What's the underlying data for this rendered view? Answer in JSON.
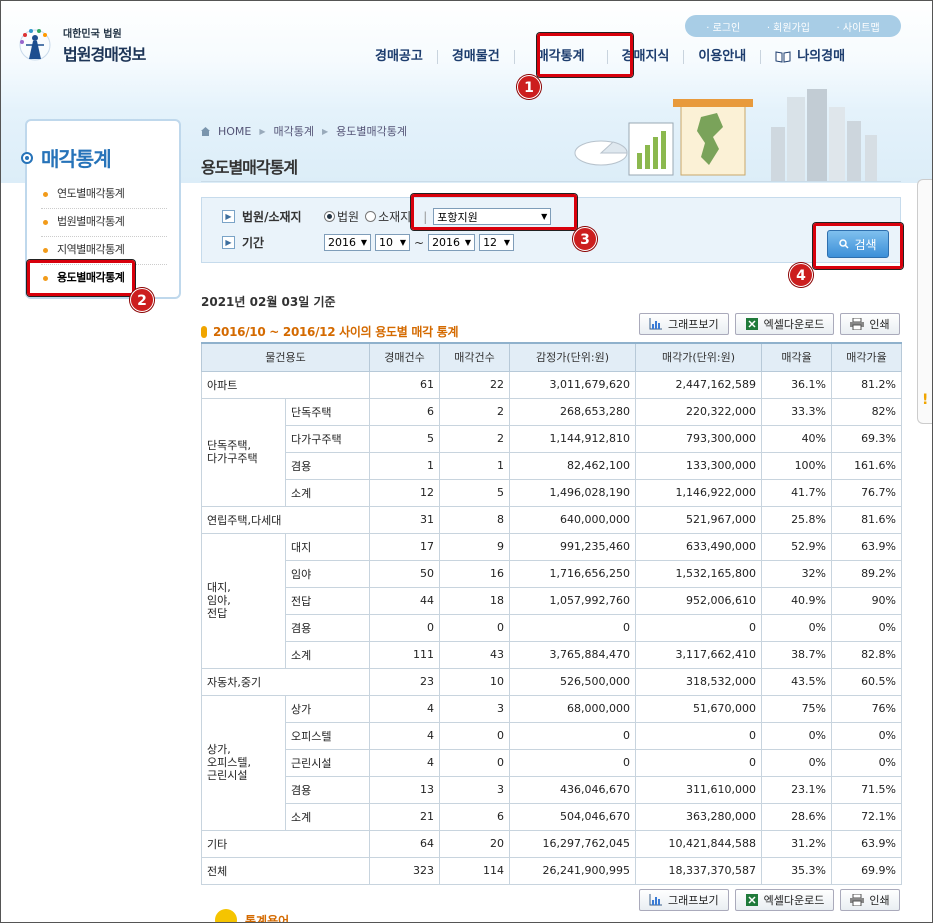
{
  "logo": {
    "subtitle": "대한민국 법원",
    "title": "법원경매정보"
  },
  "util_links": [
    "로그인",
    "회원가입",
    "사이트맵"
  ],
  "gnb": [
    "경매공고",
    "경매물건",
    "매각통계",
    "경매지식",
    "이용안내",
    "나의경매"
  ],
  "lnb": {
    "title": "매각통계",
    "items": [
      "연도별매각통계",
      "법원별매각통계",
      "지역별매각통계",
      "용도별매각통계"
    ]
  },
  "breadcrumb": [
    "HOME",
    "매각통계",
    "용도별매각통계"
  ],
  "page_title": "용도별매각통계",
  "search": {
    "court_label": "법원/소재지",
    "radio_court": "법원",
    "radio_location": "소재지",
    "court_value": "포항지원",
    "period_label": "기간",
    "from_year": "2016",
    "from_month": "10",
    "tilde": "~",
    "to_year": "2016",
    "to_month": "12",
    "search_button": "검색"
  },
  "annotations": [
    "1",
    "2",
    "3",
    "4"
  ],
  "date_basis": "2021년 02월 03일 기준",
  "section_title": "2016/10 ~ 2016/12 사이의 용도별 매각 통계",
  "toolbar": {
    "graph": "그래프보기",
    "excel": "엑셀다운로드",
    "print": "인쇄"
  },
  "table": {
    "headers": [
      "물건용도",
      "경매건수",
      "매각건수",
      "감정가(단위:원)",
      "매각가(단위:원)",
      "매각율",
      "매각가율"
    ],
    "rows": [
      {
        "group": "아파트",
        "sub": "",
        "c1": "61",
        "c2": "22",
        "c3": "3,011,679,620",
        "c4": "2,447,162,589",
        "c5": "36.1%",
        "c6": "81.2%"
      },
      {
        "group": "단독주택,\n다가구주택",
        "sub": "단독주택",
        "c1": "6",
        "c2": "2",
        "c3": "268,653,280",
        "c4": "220,322,000",
        "c5": "33.3%",
        "c6": "82%"
      },
      {
        "group": "",
        "sub": "다가구주택",
        "c1": "5",
        "c2": "2",
        "c3": "1,144,912,810",
        "c4": "793,300,000",
        "c5": "40%",
        "c6": "69.3%"
      },
      {
        "group": "",
        "sub": "겸용",
        "c1": "1",
        "c2": "1",
        "c3": "82,462,100",
        "c4": "133,300,000",
        "c5": "100%",
        "c6": "161.6%"
      },
      {
        "group": "",
        "sub": "소계",
        "c1": "12",
        "c2": "5",
        "c3": "1,496,028,190",
        "c4": "1,146,922,000",
        "c5": "41.7%",
        "c6": "76.7%"
      },
      {
        "group": "연립주택,다세대",
        "sub": "",
        "c1": "31",
        "c2": "8",
        "c3": "640,000,000",
        "c4": "521,967,000",
        "c5": "25.8%",
        "c6": "81.6%"
      },
      {
        "group": "대지,\n임야,\n전답",
        "sub": "대지",
        "c1": "17",
        "c2": "9",
        "c3": "991,235,460",
        "c4": "633,490,000",
        "c5": "52.9%",
        "c6": "63.9%"
      },
      {
        "group": "",
        "sub": "임야",
        "c1": "50",
        "c2": "16",
        "c3": "1,716,656,250",
        "c4": "1,532,165,800",
        "c5": "32%",
        "c6": "89.2%"
      },
      {
        "group": "",
        "sub": "전답",
        "c1": "44",
        "c2": "18",
        "c3": "1,057,992,760",
        "c4": "952,006,610",
        "c5": "40.9%",
        "c6": "90%"
      },
      {
        "group": "",
        "sub": "겸용",
        "c1": "0",
        "c2": "0",
        "c3": "0",
        "c4": "0",
        "c5": "0%",
        "c6": "0%"
      },
      {
        "group": "",
        "sub": "소계",
        "c1": "111",
        "c2": "43",
        "c3": "3,765,884,470",
        "c4": "3,117,662,410",
        "c5": "38.7%",
        "c6": "82.8%"
      },
      {
        "group": "자동차,중기",
        "sub": "",
        "c1": "23",
        "c2": "10",
        "c3": "526,500,000",
        "c4": "318,532,000",
        "c5": "43.5%",
        "c6": "60.5%"
      },
      {
        "group": "상가,\n오피스텔,\n근린시설",
        "sub": "상가",
        "c1": "4",
        "c2": "3",
        "c3": "68,000,000",
        "c4": "51,670,000",
        "c5": "75%",
        "c6": "76%"
      },
      {
        "group": "",
        "sub": "오피스텔",
        "c1": "4",
        "c2": "0",
        "c3": "0",
        "c4": "0",
        "c5": "0%",
        "c6": "0%"
      },
      {
        "group": "",
        "sub": "근린시설",
        "c1": "4",
        "c2": "0",
        "c3": "0",
        "c4": "0",
        "c5": "0%",
        "c6": "0%"
      },
      {
        "group": "",
        "sub": "겸용",
        "c1": "13",
        "c2": "3",
        "c3": "436,046,670",
        "c4": "311,610,000",
        "c5": "23.1%",
        "c6": "71.5%"
      },
      {
        "group": "",
        "sub": "소계",
        "c1": "21",
        "c2": "6",
        "c3": "504,046,670",
        "c4": "363,280,000",
        "c5": "28.6%",
        "c6": "72.1%"
      },
      {
        "group": "기타",
        "sub": "",
        "c1": "64",
        "c2": "20",
        "c3": "16,297,762,045",
        "c4": "10,421,844,588",
        "c5": "31.2%",
        "c6": "63.9%"
      },
      {
        "group": "전체",
        "sub": "",
        "c1": "323",
        "c2": "114",
        "c3": "26,241,900,995",
        "c4": "18,337,370,587",
        "c5": "35.3%",
        "c6": "69.9%"
      }
    ]
  },
  "notice": "통계용어",
  "colors": {
    "accent_blue": "#2673b9",
    "annotation_red": "#d8000c",
    "section_orange": "#d46a00"
  }
}
